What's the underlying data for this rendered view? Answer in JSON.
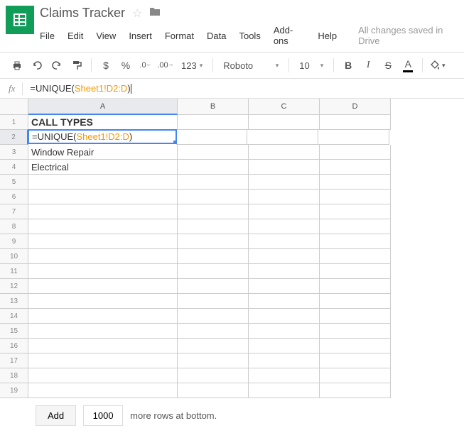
{
  "header": {
    "doc_title": "Claims Tracker",
    "save_status": "All changes saved in Drive"
  },
  "menu": {
    "file": "File",
    "edit": "Edit",
    "view": "View",
    "insert": "Insert",
    "format": "Format",
    "data": "Data",
    "tools": "Tools",
    "addons": "Add-ons",
    "help": "Help"
  },
  "toolbar": {
    "currency": "$",
    "percent": "%",
    "dec_dec": ".0",
    "inc_dec": ".00",
    "more_formats": "123",
    "font": "Roboto",
    "size": "10",
    "bold": "B",
    "italic": "I",
    "strike": "S",
    "text_color": "A"
  },
  "formula_bar": {
    "fx": "fx",
    "prefix": "=UNIQUE(",
    "ref": "Sheet1!D2:D",
    "suffix": ")"
  },
  "columns": [
    "A",
    "B",
    "C",
    "D"
  ],
  "cells": {
    "A1": "CALL TYPES",
    "A2_prefix": "=UNIQUE(",
    "A2_ref": "Sheet1!D2:D",
    "A2_suffix": ")",
    "A3": "Window Repair",
    "A4": "Electrical"
  },
  "bottom": {
    "add": "Add",
    "count": "1000",
    "suffix": "more rows at bottom."
  }
}
